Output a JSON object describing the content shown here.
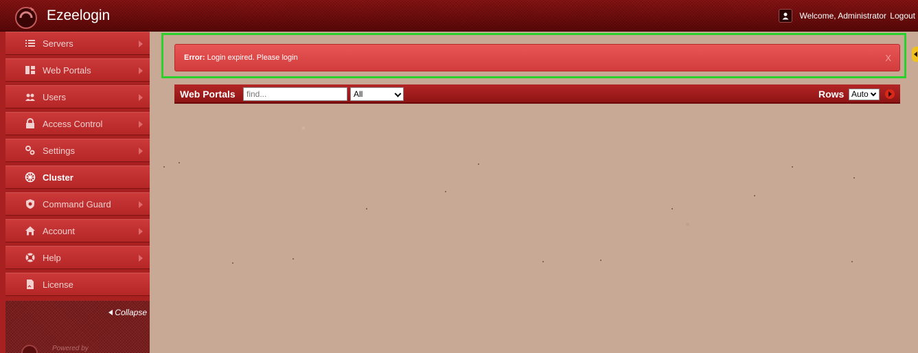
{
  "app": {
    "title": "Ezeelogin",
    "welcome_text": "Welcome, Administrator",
    "logout_label": "Logout"
  },
  "sidebar": {
    "items": [
      {
        "label": "Servers",
        "icon": "list-icon",
        "has_arrow": true
      },
      {
        "label": "Web Portals",
        "icon": "dashboard-icon",
        "has_arrow": true
      },
      {
        "label": "Users",
        "icon": "users-icon",
        "has_arrow": true
      },
      {
        "label": "Access Control",
        "icon": "lock-icon",
        "has_arrow": true
      },
      {
        "label": "Settings",
        "icon": "gears-icon",
        "has_arrow": true
      },
      {
        "label": "Cluster",
        "icon": "cluster-icon",
        "has_arrow": false,
        "active": true
      },
      {
        "label": "Command Guard",
        "icon": "shield-icon",
        "has_arrow": true
      },
      {
        "label": "Account",
        "icon": "home-icon",
        "has_arrow": true
      },
      {
        "label": "Help",
        "icon": "lifebuoy-icon",
        "has_arrow": true
      },
      {
        "label": "License",
        "icon": "document-icon",
        "has_arrow": false
      }
    ],
    "collapse_label": "Collapse",
    "powered_by": "Powered by"
  },
  "alert": {
    "prefix": "Error:",
    "message": "Login expired. Please login",
    "close_label": "X"
  },
  "portal_bar": {
    "title": "Web Portals",
    "search_placeholder": "find...",
    "filter_value": "All",
    "rows_label": "Rows",
    "rows_value": "Auto"
  },
  "colors": {
    "topbar": "#6e0a0a",
    "sidebar": "#a82020",
    "alert": "#e04848",
    "highlight": "#2ad12a",
    "background": "#c7a996"
  }
}
